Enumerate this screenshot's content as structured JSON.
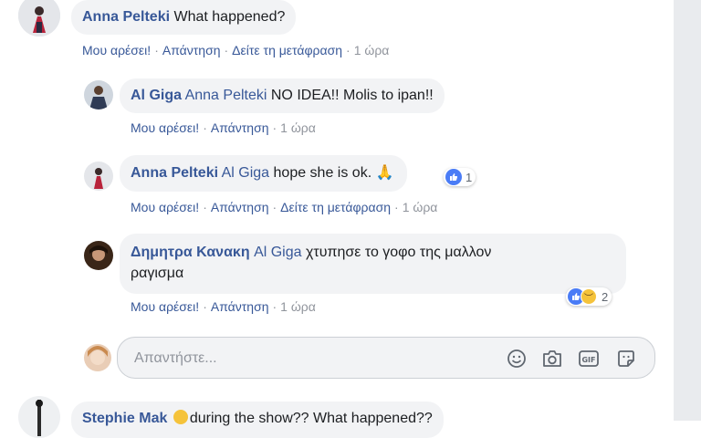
{
  "comment_main": {
    "author": "Anna Pelteki",
    "text": "What happened?",
    "actions": {
      "like": "Μου αρέσει!",
      "reply": "Απάντηση",
      "translate": "Δείτε τη μετάφραση",
      "time": "1 ώρα"
    }
  },
  "replies": [
    {
      "author": "Al Giga",
      "mention": "Anna Pelteki",
      "text": "NO IDEA!! Molis to ipan!!",
      "actions": {
        "like": "Μου αρέσει!",
        "reply": "Απάντηση",
        "time": "1 ώρα"
      }
    },
    {
      "author": "Anna Pelteki",
      "mention": "Al Giga",
      "text": "hope she is ok. 🙏",
      "reaction_count": "1",
      "actions": {
        "like": "Μου αρέσει!",
        "reply": "Απάντηση",
        "translate": "Δείτε τη μετάφραση",
        "time": "1 ώρα"
      }
    },
    {
      "author": "Δημητρα Κανακη",
      "mention": "Al Giga",
      "text_line1": "χτυπησε το γοφο της μαλλον",
      "text_line2": "ραγισμα",
      "reaction_count": "2",
      "actions": {
        "like": "Μου αρέσει!",
        "reply": "Απάντηση",
        "time": "1 ώρα"
      }
    }
  ],
  "reply_box": {
    "placeholder": "Απαντήστε...",
    "icons": [
      "smiley-icon",
      "camera-icon",
      "gif-icon",
      "sticker-icon"
    ]
  },
  "next_comment": {
    "author": "Stephie Mak",
    "text": "during the show?? What happened??"
  },
  "colors": {
    "link": "#385898",
    "bubble": "#f2f3f5",
    "meta": "#90949c",
    "like_blue": "#4a7cf6"
  }
}
